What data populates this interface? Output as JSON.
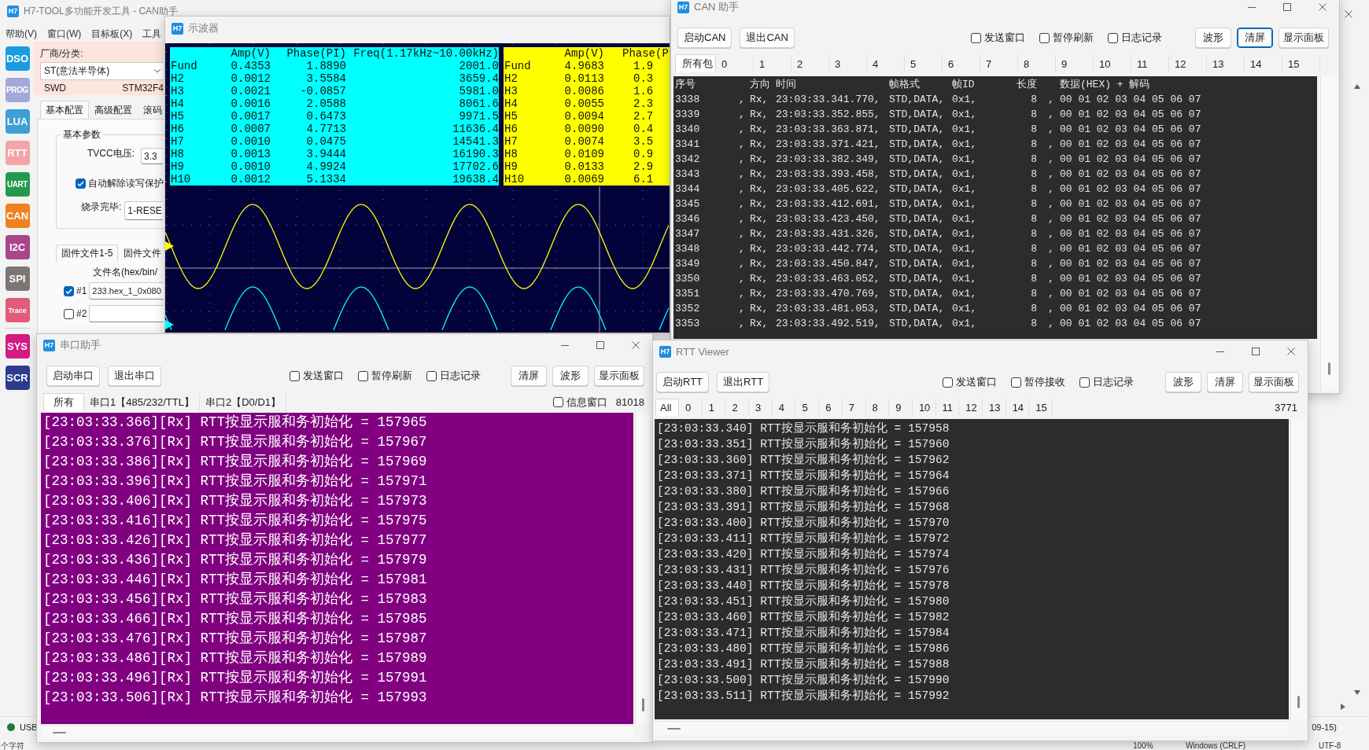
{
  "main_window": {
    "logo": "H7",
    "title": "H7-TOOL多功能开发工具 - CAN助手",
    "menu": [
      "帮助(V)",
      "窗口(W)",
      "目标板(X)",
      "工具"
    ],
    "sidebar_groups": [
      {
        "items": [
          {
            "label": "DSO",
            "color": "#1c9be2"
          },
          {
            "label": "PROG",
            "color": "#a4a8d8"
          },
          {
            "label": "LUA",
            "color": "#3d9fd6"
          },
          {
            "label": "RTT",
            "color": "#f4a3a6"
          },
          {
            "label": "UART",
            "color": "#23994f"
          },
          {
            "label": "CAN",
            "color": "#ef821f"
          },
          {
            "label": "I2C",
            "color": "#aa468c"
          },
          {
            "label": "SPI",
            "color": "#7b7673"
          },
          {
            "label": "Trace",
            "color": "#e35b7b"
          }
        ]
      },
      {
        "items": [
          {
            "label": "SYS",
            "color": "#d51a84"
          },
          {
            "label": "SCR",
            "color": "#2e3a8e"
          }
        ]
      }
    ],
    "panel": {
      "vendor": {
        "label": "厂商/分类:",
        "value": "ST(意法半导体)"
      },
      "interface": "SWD",
      "chip": "STM32F4",
      "tabs": [
        {
          "label": "基本配置",
          "selected": true
        },
        {
          "label": "高级配置",
          "selected": false
        },
        {
          "label": "滚码",
          "selected": false
        }
      ],
      "group": {
        "title": "基本参数",
        "tvcc": {
          "label": "TVCC电压:",
          "value": "3.3"
        },
        "unlock": {
          "label": "自动解除读写保护",
          "checked": true
        },
        "after_burn": {
          "label": "烧录完毕:",
          "value": "1-RESE"
        }
      },
      "file_tabs": [
        {
          "label": "固件文件1-5",
          "selected": true
        },
        {
          "label": "固件文件",
          "selected": false
        }
      ],
      "file_column": "文件名(hex/bin/",
      "files": [
        {
          "label": "#1",
          "checked": true,
          "value": "233.hex_1_0x080"
        },
        {
          "label": "#2",
          "checked": false
        }
      ]
    },
    "status_bar": {
      "connection": {
        "label": "USB",
        "connected": true
      },
      "version": "09-15)"
    }
  },
  "oscilloscope": {
    "logo": "H7",
    "title": "示波器",
    "channels": [
      {
        "color": "#00ffff",
        "columns": [
          "",
          "Amp(V)",
          "Phase(PI)",
          "Freq(1.17kHz~10.00kHz)"
        ],
        "rows": [
          [
            "Fund",
            "0.4353",
            "1.8890",
            "2001.0"
          ],
          [
            "H2",
            "0.0012",
            "3.5584",
            "3659.4"
          ],
          [
            "H3",
            "0.0021",
            "-0.0857",
            "5981.0"
          ],
          [
            "H4",
            "0.0016",
            "2.0588",
            "8061.6"
          ],
          [
            "H5",
            "0.0017",
            "0.6473",
            "9971.5"
          ],
          [
            "H6",
            "0.0007",
            "4.7713",
            "11636.4"
          ],
          [
            "H7",
            "0.0010",
            "0.0475",
            "14541.3"
          ],
          [
            "H8",
            "0.0013",
            "3.9444",
            "16190.3"
          ],
          [
            "H9",
            "0.0010",
            "4.9924",
            "17702.6"
          ],
          [
            "H10",
            "0.0012",
            "5.1334",
            "19638.4"
          ]
        ]
      },
      {
        "color": "#ffff00",
        "columns": [
          "",
          "Amp(V)",
          "Phase(P"
        ],
        "rows": [
          [
            "Fund",
            "4.9683",
            "1.9"
          ],
          [
            "H2",
            "0.0113",
            "0.3"
          ],
          [
            "H3",
            "0.0086",
            "1.6"
          ],
          [
            "H4",
            "0.0055",
            "2.3"
          ],
          [
            "H5",
            "0.0094",
            "2.7"
          ],
          [
            "H6",
            "0.0090",
            "0.4"
          ],
          [
            "H7",
            "0.0074",
            "3.5"
          ],
          [
            "H8",
            "0.0109",
            "0.9"
          ],
          [
            "H9",
            "0.0133",
            "2.9"
          ],
          [
            "H10",
            "0.0069",
            "6.1"
          ]
        ]
      }
    ]
  },
  "can_window": {
    "logo": "H7",
    "title": "CAN 助手",
    "buttons_left": [
      "启动CAN",
      "退出CAN"
    ],
    "options": [
      {
        "label": "发送窗口",
        "checked": false
      },
      {
        "label": "暂停刷新",
        "checked": false
      },
      {
        "label": "日志记录",
        "checked": false
      }
    ],
    "buttons_right": [
      {
        "label": "波形",
        "focused": false
      },
      {
        "label": "清屏",
        "focused": true
      },
      {
        "label": "显示面板",
        "focused": false
      }
    ],
    "tabs": [
      {
        "label": "所有包",
        "selected": true
      },
      {
        "label": "0",
        "selected": false
      },
      {
        "label": "1",
        "selected": false
      },
      {
        "label": "2",
        "selected": false
      },
      {
        "label": "3",
        "selected": false
      },
      {
        "label": "4",
        "selected": false
      },
      {
        "label": "5",
        "selected": false
      },
      {
        "label": "6",
        "selected": false
      },
      {
        "label": "7",
        "selected": false
      },
      {
        "label": "8",
        "selected": false
      },
      {
        "label": "9",
        "selected": false
      },
      {
        "label": "10",
        "selected": false
      },
      {
        "label": "11",
        "selected": false
      },
      {
        "label": "12",
        "selected": false
      },
      {
        "label": "13",
        "selected": false
      },
      {
        "label": "14",
        "selected": false
      },
      {
        "label": "15",
        "selected": false
      }
    ],
    "columns": [
      "序号",
      "",
      "方向",
      "时间",
      "帧格式",
      "帧ID",
      "长度",
      "",
      "数据(HEX) + 解码"
    ],
    "rows": [
      [
        "3338",
        ",",
        "Rx,",
        "23:03:33.341.770,",
        "STD,DATA,",
        "0x1,",
        "8",
        ",",
        "00 01 02 03 04 05 06 07"
      ],
      [
        "3339",
        ",",
        "Rx,",
        "23:03:33.352.855,",
        "STD,DATA,",
        "0x1,",
        "8",
        ",",
        "00 01 02 03 04 05 06 07"
      ],
      [
        "3340",
        ",",
        "Rx,",
        "23:03:33.363.871,",
        "STD,DATA,",
        "0x1,",
        "8",
        ",",
        "00 01 02 03 04 05 06 07"
      ],
      [
        "3341",
        ",",
        "Rx,",
        "23:03:33.371.421,",
        "STD,DATA,",
        "0x1,",
        "8",
        ",",
        "00 01 02 03 04 05 06 07"
      ],
      [
        "3342",
        ",",
        "Rx,",
        "23:03:33.382.349,",
        "STD,DATA,",
        "0x1,",
        "8",
        ",",
        "00 01 02 03 04 05 06 07"
      ],
      [
        "3343",
        ",",
        "Rx,",
        "23:03:33.393.458,",
        "STD,DATA,",
        "0x1,",
        "8",
        ",",
        "00 01 02 03 04 05 06 07"
      ],
      [
        "3344",
        ",",
        "Rx,",
        "23:03:33.405.622,",
        "STD,DATA,",
        "0x1,",
        "8",
        ",",
        "00 01 02 03 04 05 06 07"
      ],
      [
        "3345",
        ",",
        "Rx,",
        "23:03:33.412.691,",
        "STD,DATA,",
        "0x1,",
        "8",
        ",",
        "00 01 02 03 04 05 06 07"
      ],
      [
        "3346",
        ",",
        "Rx,",
        "23:03:33.423.450,",
        "STD,DATA,",
        "0x1,",
        "8",
        ",",
        "00 01 02 03 04 05 06 07"
      ],
      [
        "3347",
        ",",
        "Rx,",
        "23:03:33.431.326,",
        "STD,DATA,",
        "0x1,",
        "8",
        ",",
        "00 01 02 03 04 05 06 07"
      ],
      [
        "3348",
        ",",
        "Rx,",
        "23:03:33.442.774,",
        "STD,DATA,",
        "0x1,",
        "8",
        ",",
        "00 01 02 03 04 05 06 07"
      ],
      [
        "3349",
        ",",
        "Rx,",
        "23:03:33.450.847,",
        "STD,DATA,",
        "0x1,",
        "8",
        ",",
        "00 01 02 03 04 05 06 07"
      ],
      [
        "3350",
        ",",
        "Rx,",
        "23:03:33.463.052,",
        "STD,DATA,",
        "0x1,",
        "8",
        ",",
        "00 01 02 03 04 05 06 07"
      ],
      [
        "3351",
        ",",
        "Rx,",
        "23:03:33.470.769,",
        "STD,DATA,",
        "0x1,",
        "8",
        ",",
        "00 01 02 03 04 05 06 07"
      ],
      [
        "3352",
        ",",
        "Rx,",
        "23:03:33.481.053,",
        "STD,DATA,",
        "0x1,",
        "8",
        ",",
        "00 01 02 03 04 05 06 07"
      ],
      [
        "3353",
        ",",
        "Rx,",
        "23:03:33.492.519,",
        "STD,DATA,",
        "0x1,",
        "8",
        ",",
        "00 01 02 03 04 05 06 07"
      ]
    ]
  },
  "serial_window": {
    "logo": "H7",
    "title": "串口助手",
    "buttons_left": [
      "启动串口",
      "退出串口"
    ],
    "options": [
      {
        "label": "发送窗口",
        "checked": false
      },
      {
        "label": "暂停刷新",
        "checked": false
      },
      {
        "label": "日志记录",
        "checked": false
      }
    ],
    "buttons_right": [
      {
        "label": "清屏"
      },
      {
        "label": "波形"
      },
      {
        "label": "显示面板"
      }
    ],
    "tabs": [
      {
        "label": "所有",
        "selected": true
      },
      {
        "label": "串口1【485/232/TTL】",
        "selected": false
      },
      {
        "label": "串口2【D0/D1】",
        "selected": false
      }
    ],
    "info_window": {
      "label": "信息窗口",
      "checked": false
    },
    "count": "81018",
    "lines": [
      "[23:03:33.366][Rx] RTT按显示服和务初始化 = 157965",
      "[23:03:33.376][Rx] RTT按显示服和务初始化 = 157967",
      "[23:03:33.386][Rx] RTT按显示服和务初始化 = 157969",
      "[23:03:33.396][Rx] RTT按显示服和务初始化 = 157971",
      "[23:03:33.406][Rx] RTT按显示服和务初始化 = 157973",
      "[23:03:33.416][Rx] RTT按显示服和务初始化 = 157975",
      "[23:03:33.426][Rx] RTT按显示服和务初始化 = 157977",
      "[23:03:33.436][Rx] RTT按显示服和务初始化 = 157979",
      "[23:03:33.446][Rx] RTT按显示服和务初始化 = 157981",
      "[23:03:33.456][Rx] RTT按显示服和务初始化 = 157983",
      "[23:03:33.466][Rx] RTT按显示服和务初始化 = 157985",
      "[23:03:33.476][Rx] RTT按显示服和务初始化 = 157987",
      "[23:03:33.486][Rx] RTT按显示服和务初始化 = 157989",
      "[23:03:33.496][Rx] RTT按显示服和务初始化 = 157991",
      "[23:03:33.506][Rx] RTT按显示服和务初始化 = 157993"
    ]
  },
  "rtt_window": {
    "logo": "H7",
    "title": "RTT Viewer",
    "buttons_left": [
      "启动RTT",
      "退出RTT"
    ],
    "options": [
      {
        "label": "发送窗口",
        "checked": false
      },
      {
        "label": "暂停接收",
        "checked": false
      },
      {
        "label": "日志记录",
        "checked": false
      }
    ],
    "buttons_right": [
      {
        "label": "波形"
      },
      {
        "label": "清屏"
      },
      {
        "label": "显示面板"
      }
    ],
    "tabs": [
      {
        "label": "All",
        "selected": true
      },
      {
        "label": "0",
        "selected": false
      },
      {
        "label": "1",
        "selected": false
      },
      {
        "label": "2",
        "selected": false
      },
      {
        "label": "3",
        "selected": false
      },
      {
        "label": "4",
        "selected": false
      },
      {
        "label": "5",
        "selected": false
      },
      {
        "label": "6",
        "selected": false
      },
      {
        "label": "7",
        "selected": false
      },
      {
        "label": "8",
        "selected": false
      },
      {
        "label": "9",
        "selected": false
      },
      {
        "label": "10",
        "selected": false
      },
      {
        "label": "11",
        "selected": false
      },
      {
        "label": "12",
        "selected": false
      },
      {
        "label": "13",
        "selected": false
      },
      {
        "label": "14",
        "selected": false
      },
      {
        "label": "15",
        "selected": false
      }
    ],
    "count": "3771",
    "lines": [
      "[23:03:33.340] RTT按显示服和务初始化 = 157958",
      "[23:03:33.351] RTT按显示服和务初始化 = 157960",
      "[23:03:33.360] RTT按显示服和务初始化 = 157962",
      "[23:03:33.371] RTT按显示服和务初始化 = 157964",
      "[23:03:33.380] RTT按显示服和务初始化 = 157966",
      "[23:03:33.391] RTT按显示服和务初始化 = 157968",
      "[23:03:33.400] RTT按显示服和务初始化 = 157970",
      "[23:03:33.411] RTT按显示服和务初始化 = 157972",
      "[23:03:33.420] RTT按显示服和务初始化 = 157974",
      "[23:03:33.431] RTT按显示服和务初始化 = 157976",
      "[23:03:33.440] RTT按显示服和务初始化 = 157978",
      "[23:03:33.451] RTT按显示服和务初始化 = 157980",
      "[23:03:33.460] RTT按显示服和务初始化 = 157982",
      "[23:03:33.471] RTT按显示服和务初始化 = 157984",
      "[23:03:33.480] RTT按显示服和务初始化 = 157986",
      "[23:03:33.491] RTT按显示服和务初始化 = 157988",
      "[23:03:33.500] RTT按显示服和务初始化 = 157990",
      "[23:03:33.511] RTT按显示服和务初始化 = 157992"
    ]
  },
  "editor_status_bar": {
    "text": "个字符",
    "items": [
      "100%",
      "Windows (CRLF)",
      "UTF-8"
    ]
  }
}
